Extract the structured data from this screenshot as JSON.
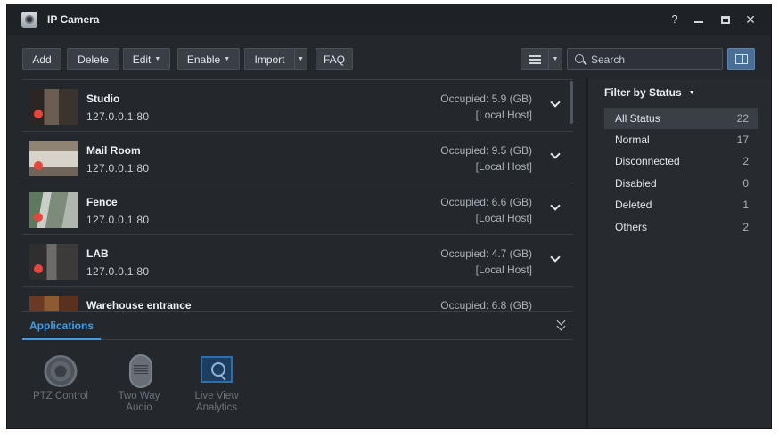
{
  "window": {
    "title": "IP Camera",
    "help_label": "?",
    "close_label": "✕"
  },
  "toolbar": {
    "add_label": "Add",
    "delete_label": "Delete",
    "edit_label": "Edit",
    "enable_label": "Enable",
    "import_label": "Import",
    "faq_label": "FAQ",
    "dropdown_caret": "▼",
    "search_placeholder": "Search"
  },
  "cameras": [
    {
      "name": "Studio",
      "address": "127.0.0.1:80",
      "occupied": "Occupied: 5.9 (GB)",
      "host": "[Local Host]",
      "status_color": "#e8463d"
    },
    {
      "name": "Mail Room",
      "address": "127.0.0.1:80",
      "occupied": "Occupied: 9.5 (GB)",
      "host": "[Local Host]",
      "status_color": "#e8463d"
    },
    {
      "name": "Fence",
      "address": "127.0.0.1:80",
      "occupied": "Occupied: 6.6 (GB)",
      "host": "[Local Host]",
      "status_color": "#e8463d"
    },
    {
      "name": "LAB",
      "address": "127.0.0.1:80",
      "occupied": "Occupied: 4.7 (GB)",
      "host": "[Local Host]",
      "status_color": "#e8463d"
    },
    {
      "name": "Warehouse entrance",
      "address": "",
      "occupied": "Occupied: 6.8 (GB)",
      "host": "",
      "status_color": "#e8463d"
    }
  ],
  "applications": {
    "tab_label": "Applications",
    "items": [
      {
        "label_line1": "PTZ Control",
        "label_line2": "",
        "icon": "ptz-control-icon"
      },
      {
        "label_line1": "Two Way",
        "label_line2": "Audio",
        "icon": "two-way-audio-icon"
      },
      {
        "label_line1": "Live View",
        "label_line2": "Analytics",
        "icon": "live-view-analytics-icon"
      }
    ]
  },
  "filter": {
    "header": "Filter by Status",
    "items": [
      {
        "label": "All Status",
        "count": "22",
        "selected": true
      },
      {
        "label": "Normal",
        "count": "17"
      },
      {
        "label": "Disconnected",
        "count": "2"
      },
      {
        "label": "Disabled",
        "count": "0"
      },
      {
        "label": "Deleted",
        "count": "1"
      },
      {
        "label": "Others",
        "count": "2"
      }
    ]
  },
  "colors": {
    "accent": "#3e9de4",
    "background": "#24282d",
    "recording": "#e8463d"
  }
}
